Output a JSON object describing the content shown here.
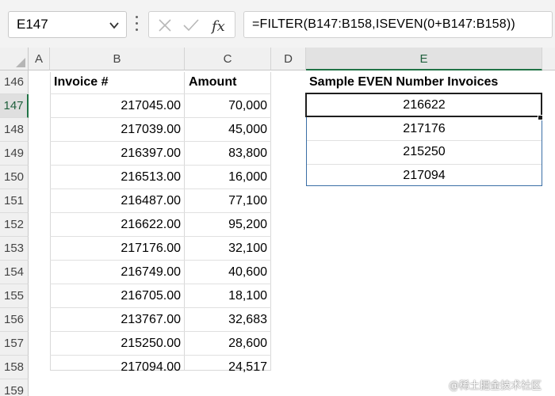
{
  "name_box": {
    "value": "E147"
  },
  "formula_bar": {
    "formula": "=FILTER(B147:B158,ISEVEN(0+B147:B158))"
  },
  "icons": {
    "cancel": "x-icon",
    "enter": "check-icon",
    "function": "fx-icon",
    "dropdown": "chevron-down-icon"
  },
  "columns": [
    "A",
    "B",
    "C",
    "D",
    "E"
  ],
  "rows": [
    "146",
    "147",
    "148",
    "149",
    "150",
    "151",
    "152",
    "153",
    "154",
    "155",
    "156",
    "157",
    "158",
    "159"
  ],
  "table": {
    "headers": {
      "invoice": "Invoice #",
      "amount": "Amount"
    },
    "rows": [
      {
        "invoice": "217045.00",
        "amount": "70,000"
      },
      {
        "invoice": "217039.00",
        "amount": "45,000"
      },
      {
        "invoice": "216397.00",
        "amount": "83,800"
      },
      {
        "invoice": "216513.00",
        "amount": "16,000"
      },
      {
        "invoice": "216487.00",
        "amount": "77,100"
      },
      {
        "invoice": "216622.00",
        "amount": "95,200"
      },
      {
        "invoice": "217176.00",
        "amount": "32,100"
      },
      {
        "invoice": "216749.00",
        "amount": "40,600"
      },
      {
        "invoice": "216705.00",
        "amount": "18,100"
      },
      {
        "invoice": "213767.00",
        "amount": "32,683"
      },
      {
        "invoice": "215250.00",
        "amount": "28,600"
      },
      {
        "invoice": "217094.00",
        "amount": "24,517"
      }
    ]
  },
  "results": {
    "header": "Sample EVEN Number Invoices",
    "values": [
      "216622",
      "217176",
      "215250",
      "217094"
    ]
  },
  "watermark": "@稀土掘金技术社区",
  "colors": {
    "accent": "#217346",
    "result_border": "#3a6ea5"
  }
}
